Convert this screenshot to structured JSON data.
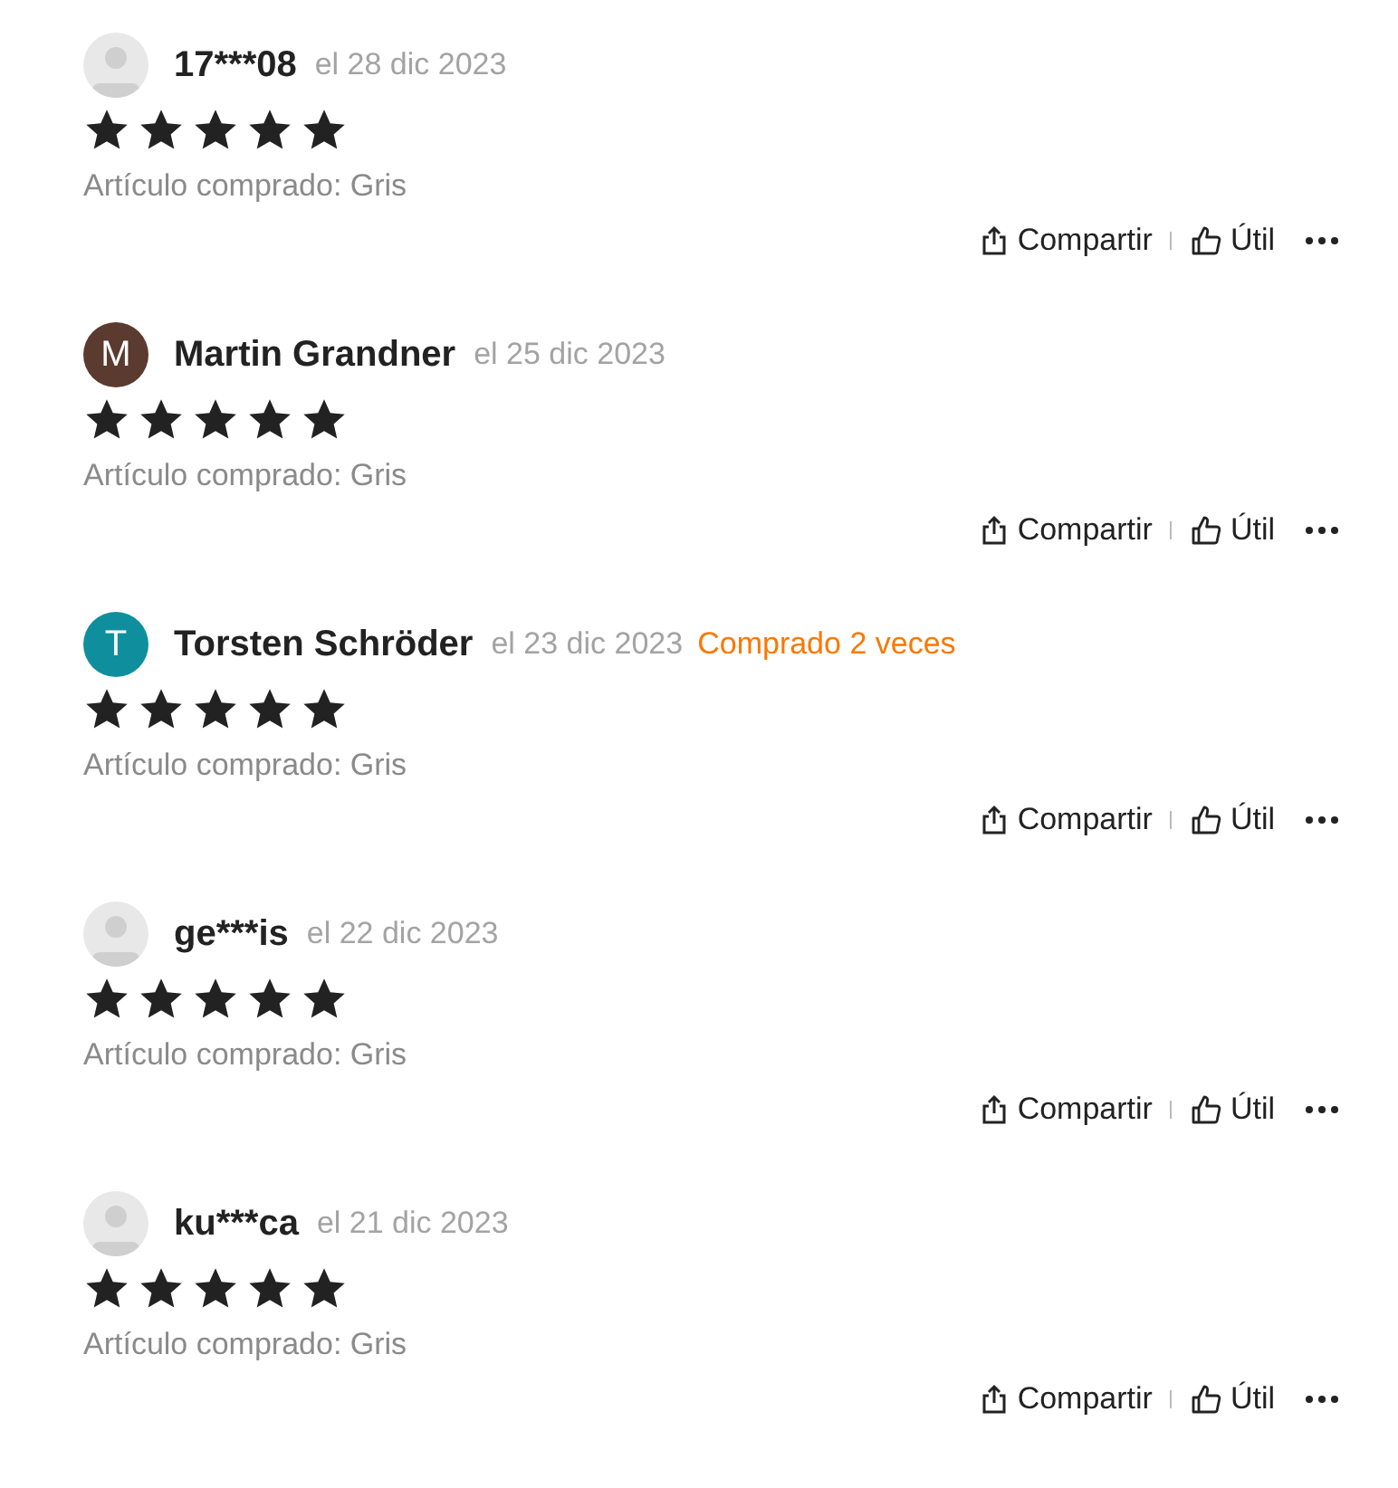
{
  "reviews": [
    {
      "avatar": {
        "kind": "placeholder"
      },
      "name": "17***08",
      "date": "el 28 dic 2023",
      "stars": 5,
      "purchase": "Artículo comprado: Gris",
      "share": "Compartir",
      "helpful": "Útil"
    },
    {
      "avatar": {
        "kind": "initial",
        "letter": "M",
        "color": "#5b3a30"
      },
      "name": "Martin Grandner",
      "date": "el 25 dic 2023",
      "stars": 5,
      "purchase": "Artículo comprado: Gris",
      "share": "Compartir",
      "helpful": "Útil"
    },
    {
      "avatar": {
        "kind": "initial",
        "letter": "T",
        "color": "#0f8f9e"
      },
      "name": "Torsten Schröder",
      "date": "el 23 dic 2023",
      "badge": "Comprado 2 veces",
      "stars": 5,
      "purchase": "Artículo comprado: Gris",
      "share": "Compartir",
      "helpful": "Útil"
    },
    {
      "avatar": {
        "kind": "placeholder"
      },
      "name": "ge***is",
      "date": "el 22 dic 2023",
      "stars": 5,
      "purchase": "Artículo comprado: Gris",
      "share": "Compartir",
      "helpful": "Útil"
    },
    {
      "avatar": {
        "kind": "placeholder"
      },
      "name": "ku***ca",
      "date": "el 21 dic 2023",
      "stars": 5,
      "purchase": "Artículo comprado: Gris",
      "share": "Compartir",
      "helpful": "Útil"
    }
  ]
}
